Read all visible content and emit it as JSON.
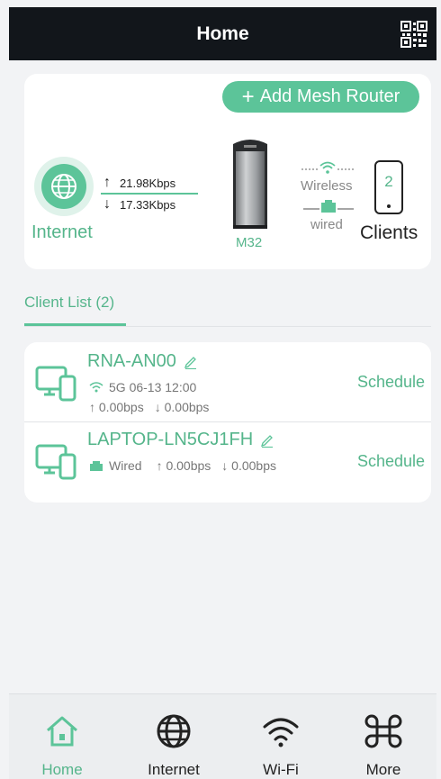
{
  "header": {
    "title": "Home"
  },
  "topology": {
    "add_button": "Add Mesh Router",
    "internet_label": "Internet",
    "upload_speed": "21.98Kbps",
    "download_speed": "17.33Kbps",
    "router_model": "M32",
    "wireless_label": "Wireless",
    "wired_label": "wired",
    "client_count": "2",
    "clients_label": "Clients"
  },
  "client_list": {
    "tab_label": "Client List (2)",
    "clients": [
      {
        "name": "RNA-AN00",
        "connection": "5G 06-13 12:00",
        "up": "0.00bps",
        "down": "0.00bps",
        "action": "Schedule"
      },
      {
        "name": "LAPTOP-LN5CJ1FH",
        "connection": "Wired",
        "up": "0.00bps",
        "down": "0.00bps",
        "action": "Schedule"
      }
    ]
  },
  "nav": {
    "items": [
      {
        "label": "Home",
        "icon": "home-icon",
        "active": true
      },
      {
        "label": "Internet",
        "icon": "globe-icon",
        "active": false
      },
      {
        "label": "Wi-Fi",
        "icon": "wifi-icon",
        "active": false
      },
      {
        "label": "More",
        "icon": "more-icon",
        "active": false
      }
    ]
  },
  "colors": {
    "accent": "#5cc499",
    "header_bg": "#12161b",
    "page_bg": "#f2f3f5"
  }
}
